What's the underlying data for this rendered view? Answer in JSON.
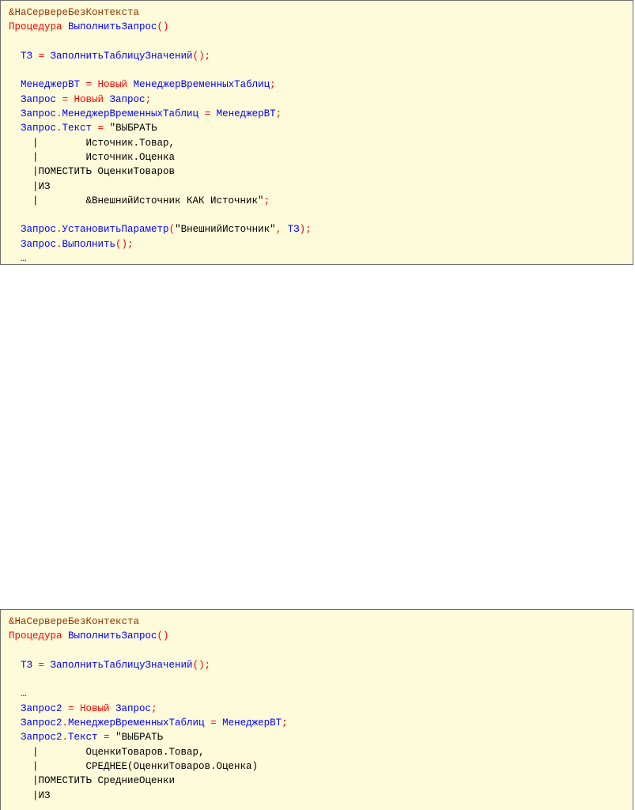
{
  "colors": {
    "background": "#fdfbd9",
    "border": "#6f6f6f",
    "keyword": "#ff0000",
    "identifier": "#0000ff",
    "string": "#000000",
    "directive": "#963200"
  },
  "blocks": [
    {
      "lines": [
        [
          {
            "t": "&НаСервереБезКонтекста",
            "c": "dir"
          }
        ],
        [
          {
            "t": "Процедура ",
            "c": "kw"
          },
          {
            "t": "ВыполнитьЗапрос",
            "c": "id"
          },
          {
            "t": "()",
            "c": "op"
          }
        ],
        [],
        [
          {
            "t": "  ТЗ ",
            "c": "id"
          },
          {
            "t": "= ",
            "c": "op"
          },
          {
            "t": "ЗаполнитьТаблицуЗначений",
            "c": "id"
          },
          {
            "t": "();",
            "c": "op"
          }
        ],
        [],
        [
          {
            "t": "  МенеджерВТ ",
            "c": "id"
          },
          {
            "t": "= ",
            "c": "op"
          },
          {
            "t": "Новый ",
            "c": "kw"
          },
          {
            "t": "МенеджерВременныхТаблиц",
            "c": "id"
          },
          {
            "t": ";",
            "c": "op"
          }
        ],
        [
          {
            "t": "  Запрос ",
            "c": "id"
          },
          {
            "t": "= ",
            "c": "op"
          },
          {
            "t": "Новый ",
            "c": "kw"
          },
          {
            "t": "Запрос",
            "c": "id"
          },
          {
            "t": ";",
            "c": "op"
          }
        ],
        [
          {
            "t": "  Запрос",
            "c": "id"
          },
          {
            "t": ".",
            "c": "op"
          },
          {
            "t": "МенеджерВременныхТаблиц ",
            "c": "id"
          },
          {
            "t": "= ",
            "c": "op"
          },
          {
            "t": "МенеджерВТ",
            "c": "id"
          },
          {
            "t": ";",
            "c": "op"
          }
        ],
        [
          {
            "t": "  Запрос",
            "c": "id"
          },
          {
            "t": ".",
            "c": "op"
          },
          {
            "t": "Текст ",
            "c": "id"
          },
          {
            "t": "= ",
            "c": "op"
          },
          {
            "t": "\"ВЫБРАТЬ",
            "c": "str"
          }
        ],
        [
          {
            "t": "    |        Источник.Товар,",
            "c": "str"
          }
        ],
        [
          {
            "t": "    |        Источник.Оценка",
            "c": "str"
          }
        ],
        [
          {
            "t": "    |ПОМЕСТИТЬ ОценкиТоваров",
            "c": "str"
          }
        ],
        [
          {
            "t": "    |ИЗ",
            "c": "str"
          }
        ],
        [
          {
            "t": "    |        &ВнешнийИсточник КАК Источник\"",
            "c": "str"
          },
          {
            "t": ";",
            "c": "op"
          }
        ],
        [],
        [
          {
            "t": "  Запрос",
            "c": "id"
          },
          {
            "t": ".",
            "c": "op"
          },
          {
            "t": "УстановитьПараметр",
            "c": "id"
          },
          {
            "t": "(",
            "c": "op"
          },
          {
            "t": "\"ВнешнийИсточник\"",
            "c": "str"
          },
          {
            "t": ", ",
            "c": "op"
          },
          {
            "t": "ТЗ",
            "c": "id"
          },
          {
            "t": ");",
            "c": "op"
          }
        ],
        [
          {
            "t": "  Запрос",
            "c": "id"
          },
          {
            "t": ".",
            "c": "op"
          },
          {
            "t": "Выполнить",
            "c": "id"
          },
          {
            "t": "();",
            "c": "op"
          }
        ],
        [
          {
            "t": "  …",
            "c": "id"
          }
        ]
      ]
    },
    {
      "lines": [
        [
          {
            "t": "&НаСервереБезКонтекста",
            "c": "dir"
          }
        ],
        [
          {
            "t": "Процедура ",
            "c": "kw"
          },
          {
            "t": "ВыполнитьЗапрос",
            "c": "id"
          },
          {
            "t": "()",
            "c": "op"
          }
        ],
        [],
        [
          {
            "t": "  ТЗ ",
            "c": "id"
          },
          {
            "t": "= ",
            "c": "op"
          },
          {
            "t": "ЗаполнитьТаблицуЗначений",
            "c": "id"
          },
          {
            "t": "();",
            "c": "op"
          }
        ],
        [],
        [
          {
            "t": "  …",
            "c": "id"
          }
        ],
        [
          {
            "t": "  Запрос2 ",
            "c": "id"
          },
          {
            "t": "= ",
            "c": "op"
          },
          {
            "t": "Новый ",
            "c": "kw"
          },
          {
            "t": "Запрос",
            "c": "id"
          },
          {
            "t": ";",
            "c": "op"
          }
        ],
        [
          {
            "t": "  Запрос2",
            "c": "id"
          },
          {
            "t": ".",
            "c": "op"
          },
          {
            "t": "МенеджерВременныхТаблиц ",
            "c": "id"
          },
          {
            "t": "= ",
            "c": "op"
          },
          {
            "t": "МенеджерВТ",
            "c": "id"
          },
          {
            "t": ";",
            "c": "op"
          }
        ],
        [
          {
            "t": "  Запрос2",
            "c": "id"
          },
          {
            "t": ".",
            "c": "op"
          },
          {
            "t": "Текст ",
            "c": "id"
          },
          {
            "t": "= ",
            "c": "op"
          },
          {
            "t": "\"ВЫБРАТЬ",
            "c": "str"
          }
        ],
        [
          {
            "t": "    |        ОценкиТоваров.Товар,",
            "c": "str"
          }
        ],
        [
          {
            "t": "    |        СРЕДНЕЕ(ОценкиТоваров.Оценка)",
            "c": "str"
          }
        ],
        [
          {
            "t": "    |ПОМЕСТИТЬ СредниеОценки",
            "c": "str"
          }
        ],
        [
          {
            "t": "    |ИЗ",
            "c": "str"
          }
        ]
      ]
    }
  ]
}
